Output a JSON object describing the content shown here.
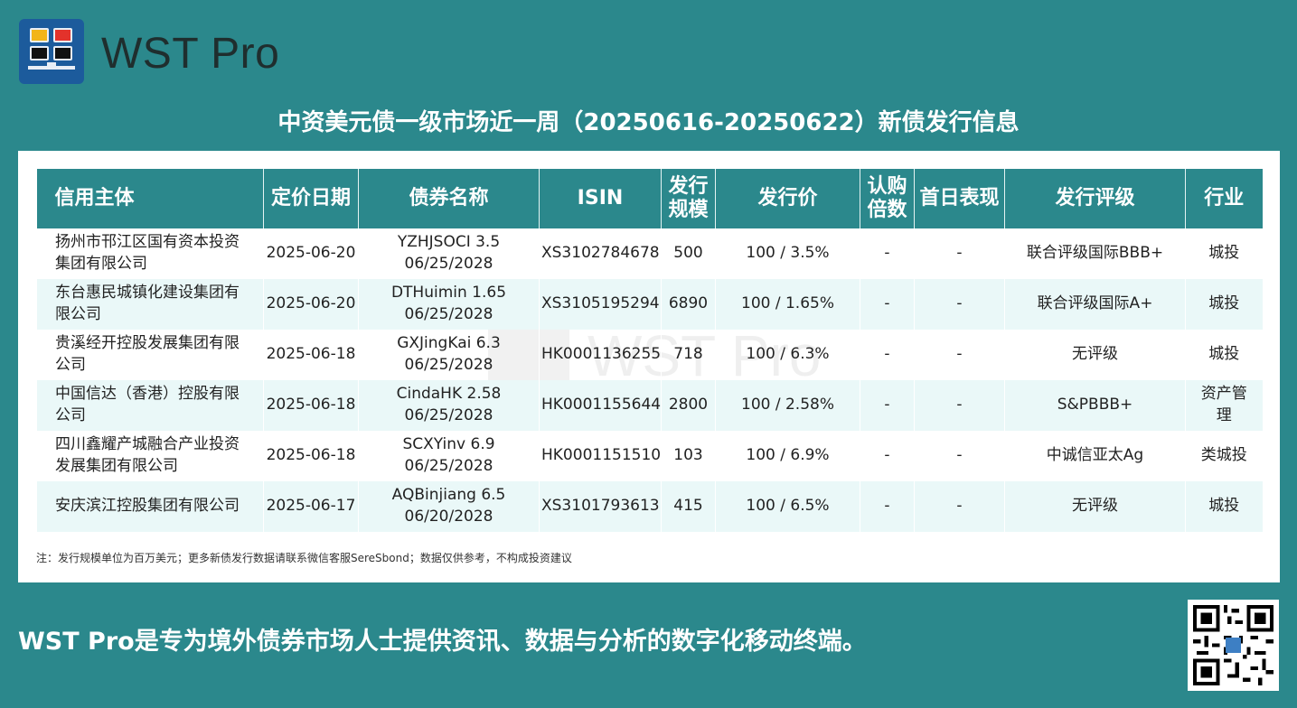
{
  "logo": {
    "text": "WST Pro"
  },
  "title": "中资美元债一级市场近一周（20250616-20250622）新债发行信息",
  "table": {
    "headers": [
      "信用主体",
      "定价日期",
      "债券名称",
      "ISIN",
      "发行\n规模",
      "发行价",
      "认购\n倍数",
      "首日表现",
      "发行评级",
      "行业"
    ],
    "rows": [
      [
        "扬州市邗江区国有资本投资\n集团有限公司",
        "2025-06-20",
        "YZHJSOCI 3.5\n06/25/2028",
        "XS3102784678",
        "500",
        "100 / 3.5%",
        "-",
        "-",
        "联合评级国际BBB+",
        "城投"
      ],
      [
        "东台惠民城镇化建设集团有\n限公司",
        "2025-06-20",
        "DTHuimin 1.65\n06/25/2028",
        "XS3105195294",
        "6890",
        "100 / 1.65%",
        "-",
        "-",
        "联合评级国际A+",
        "城投"
      ],
      [
        "贵溪经开控股发展集团有限\n公司",
        "2025-06-18",
        "GXJingKai 6.3\n06/25/2028",
        "HK0001136255",
        "718",
        "100 / 6.3%",
        "-",
        "-",
        "无评级",
        "城投"
      ],
      [
        "中国信达（香港）控股有限\n公司",
        "2025-06-18",
        "CindaHK 2.58\n06/25/2028",
        "HK0001155644",
        "2800",
        "100 / 2.58%",
        "-",
        "-",
        "S&PBBB+",
        "资产管\n理"
      ],
      [
        "四川鑫耀产城融合产业投资\n发展集团有限公司",
        "2025-06-18",
        "SCXYinv 6.9\n06/25/2028",
        "HK0001151510",
        "103",
        "100 / 6.9%",
        "-",
        "-",
        "中诚信亚太Ag",
        "类城投"
      ],
      [
        "安庆滨江控股集团有限公司",
        "2025-06-17",
        "AQBinjiang 6.5\n06/20/2028",
        "XS3101793613",
        "415",
        "100 / 6.5%",
        "-",
        "-",
        "无评级",
        "城投"
      ]
    ]
  },
  "note": "注：发行规模单位为百万美元；更多新债发行数据请联系微信客服SereSbond；数据仅供参考，不构成投资建议",
  "slogan": "WST Pro是专为境外债券市场人士提供资讯、数据与分析的数字化移动终端。",
  "colors": {
    "background": "#2b888c",
    "header": "#2b888c",
    "alt_row": "#eaf8f8"
  }
}
